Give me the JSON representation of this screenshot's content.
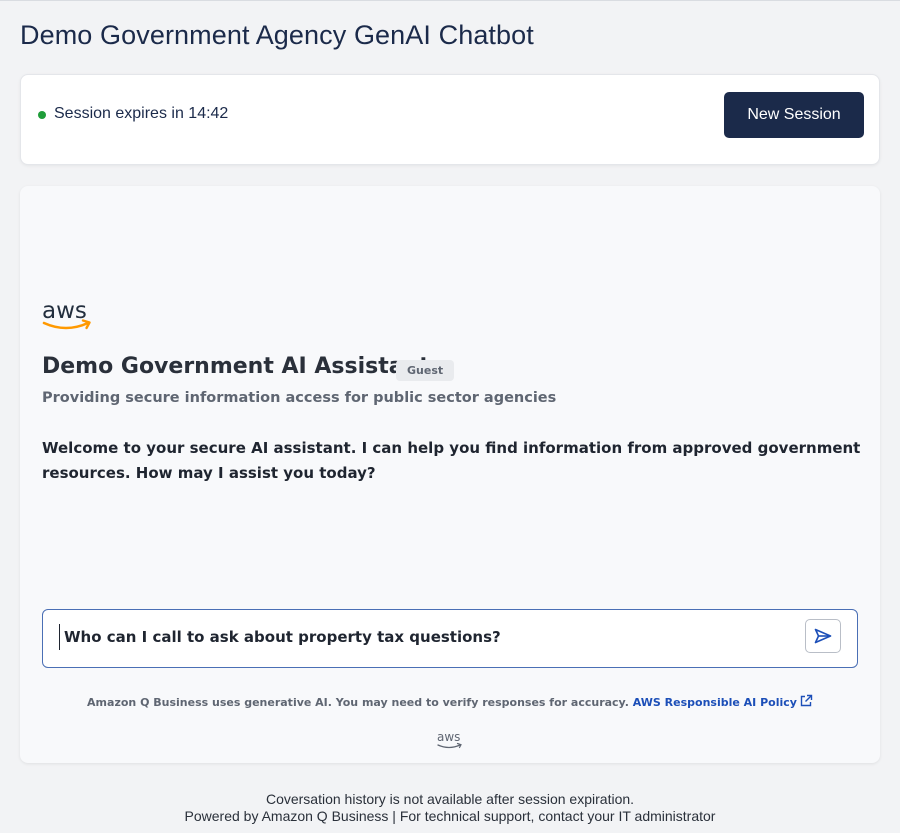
{
  "app": {
    "title": "Demo Government Agency GenAI Chatbot"
  },
  "session": {
    "status_text": "Session expires in 14:42",
    "status_color": "#1f9d3a",
    "new_session_label": "New Session"
  },
  "chat": {
    "logo_text": "aws",
    "assistant_name": "Demo Government AI Assistant",
    "badge": "Guest",
    "subtitle": "Providing secure information access for public sector agencies",
    "welcome": "Welcome to your secure AI assistant. I can help you find information from approved government resources. How may I assist you today?",
    "prompt_value": "Who can I call to ask about property tax questions?",
    "send_icon": "send-icon",
    "disclaimer": "Amazon Q Business uses generative AI. You may need to verify responses for accuracy.",
    "policy_link": "AWS Responsible AI Policy",
    "policy_icon": "external-link-icon",
    "footer_logo_text": "aws"
  },
  "footer": {
    "line1": "Coversation history is not available after session expiration.",
    "line2": "Powered by Amazon Q Business | For technical support, contact your IT administrator"
  },
  "colors": {
    "brand_navy": "#1b2a4a",
    "link_blue": "#1c4fb8",
    "aws_orange": "#ff9900"
  }
}
